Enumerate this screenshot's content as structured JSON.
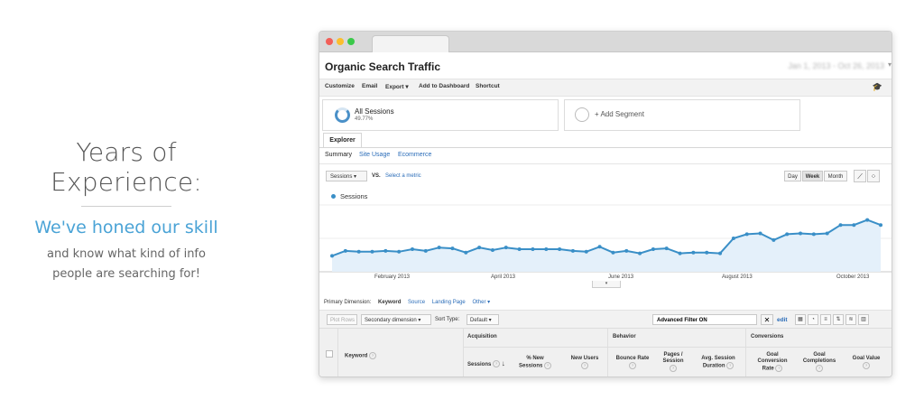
{
  "marketing": {
    "heading": "Years of Experience:",
    "tagline": "We've honed our skill",
    "line1": "and know what kind of info",
    "line2": "people are searching for!"
  },
  "report": {
    "title": "Organic Search Traffic",
    "date_range": "Jan 1, 2013 - Oct 26, 2013"
  },
  "toolbar": {
    "customize": "Customize",
    "email": "Email",
    "export": "Export ▾",
    "add_to_dashboard": "Add to Dashboard",
    "shortcut": "Shortcut"
  },
  "segments": {
    "all_label": "All Sessions",
    "all_value": "49.77%",
    "add_label": "+ Add Segment"
  },
  "tabs": {
    "explorer": "Explorer",
    "summary": "Summary",
    "site_usage": "Site Usage",
    "ecommerce": "Ecommerce"
  },
  "controls": {
    "metric": "Sessions",
    "vs": "VS.",
    "select_metric": "Select a metric",
    "day": "Day",
    "week": "Week",
    "month": "Month"
  },
  "chart_data": {
    "type": "area",
    "series": [
      {
        "name": "Sessions",
        "values": [
          19,
          25,
          24,
          24,
          25,
          24,
          27,
          25,
          29,
          28,
          23,
          29,
          26,
          29,
          27,
          27,
          27,
          27,
          25,
          24,
          30,
          23,
          25,
          22,
          27,
          28,
          22,
          23,
          23,
          22,
          40,
          45,
          46,
          38,
          45,
          46,
          45,
          46,
          56,
          56,
          62,
          56
        ]
      }
    ],
    "x_tick_labels": [
      "February 2013",
      "April 2013",
      "June 2013",
      "August 2013",
      "October 2013"
    ],
    "ylim": [
      0,
      80
    ],
    "color": "#3a8fc7",
    "fill": "#e4f0fa"
  },
  "dimension": {
    "label": "Primary Dimension:",
    "keyword": "Keyword",
    "source": "Source",
    "landing_page": "Landing Page",
    "other": "Other ▾"
  },
  "filter": {
    "plot_rows": "Plot Rows",
    "secondary": "Secondary dimension ▾",
    "sort_type": "Sort Type:",
    "default": "Default ▾",
    "advanced": "Advanced Filter ON",
    "close": "✕",
    "edit": "edit"
  },
  "table": {
    "groups": {
      "acquisition": "Acquisition",
      "behavior": "Behavior",
      "conversions": "Conversions"
    },
    "keyword": "Keyword",
    "sessions": "Sessions",
    "new_sessions_1": "% New",
    "new_sessions_2": "Sessions",
    "new_users": "New Users",
    "bounce_rate": "Bounce Rate",
    "pages_1": "Pages /",
    "pages_2": "Session",
    "avg_1": "Avg. Session",
    "avg_2": "Duration",
    "gcr_1": "Goal",
    "gcr_2": "Conversion",
    "gcr_3": "Rate",
    "gc_1": "Goal",
    "gc_2": "Completions",
    "goal_value": "Goal Value"
  }
}
